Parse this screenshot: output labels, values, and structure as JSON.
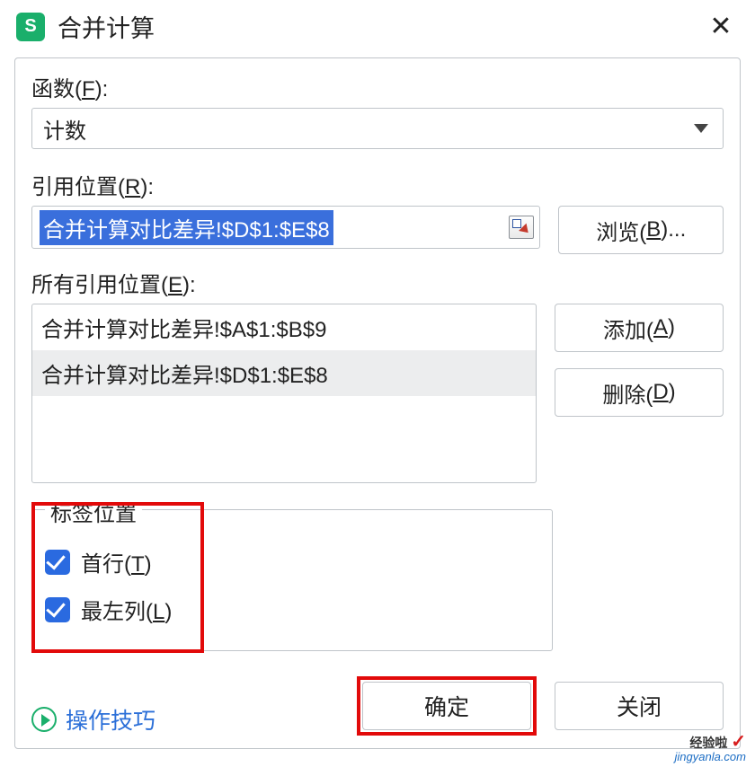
{
  "title": "合并计算",
  "app_icon_letter": "S",
  "labels": {
    "function": "函数(",
    "function_u": "F",
    "function_end": "):",
    "reference": "引用位置(",
    "reference_u": "R",
    "reference_end": "):",
    "all_refs": "所有引用位置(",
    "all_refs_u": "E",
    "all_refs_end": "):",
    "labels_group": "标签位置",
    "top_row": "首行(",
    "top_row_u": "T",
    "top_row_end": ")",
    "left_col": "最左列(",
    "left_col_u": "L",
    "left_col_end": ")"
  },
  "function_value": "计数",
  "reference_value": "合并计算对比差异!$D$1:$E$8",
  "all_references": [
    {
      "text": "合并计算对比差异!$A$1:$B$9",
      "selected": false
    },
    {
      "text": "合并计算对比差异!$D$1:$E$8",
      "selected": true
    }
  ],
  "buttons": {
    "browse": "浏览(",
    "browse_u": "B",
    "browse_end": ")...",
    "add": "添加(",
    "add_u": "A",
    "add_end": ")",
    "delete": "删除(",
    "delete_u": "D",
    "delete_end": ")",
    "ok": "确定",
    "close": "关闭"
  },
  "tips_label": "操作技巧",
  "watermark": {
    "brand": "经验啦",
    "check": "✓",
    "url": "jingyanla.com"
  }
}
